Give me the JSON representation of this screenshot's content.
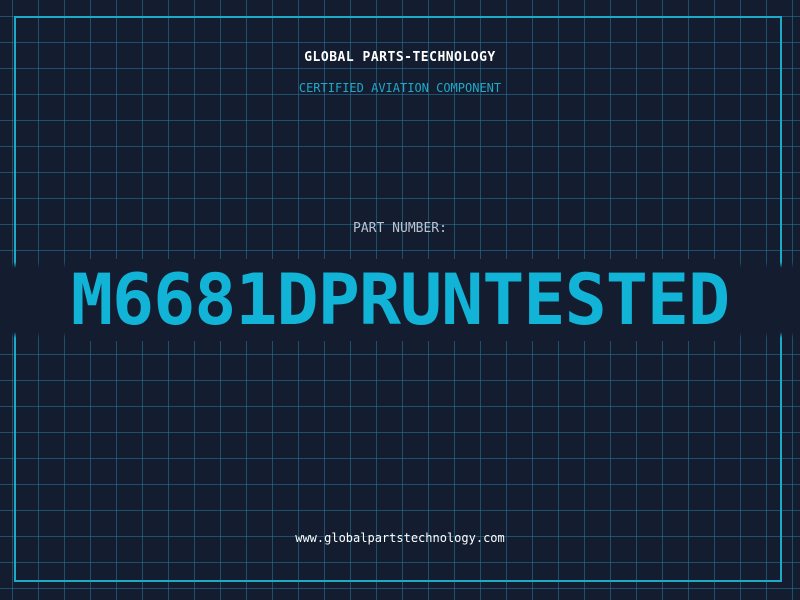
{
  "header": {
    "brand": "GLOBAL PARTS-TECHNOLOGY",
    "subtitle": "CERTIFIED AVIATION COMPONENT"
  },
  "part": {
    "label": "PART NUMBER:",
    "number": "M6681DPRUNTESTED"
  },
  "footer": {
    "url": "www.globalpartstechnology.com"
  },
  "colors": {
    "background": "#141c2f",
    "grid": "#28789f",
    "accent": "#11b3d6",
    "text": "#ffffff",
    "label": "#b9c3d0"
  }
}
